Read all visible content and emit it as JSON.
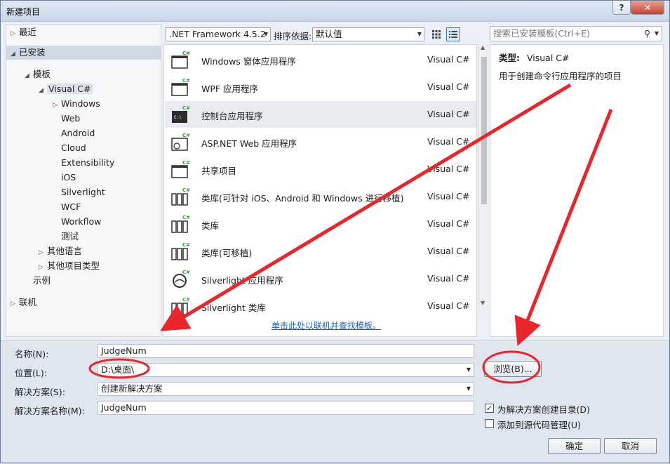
{
  "window": {
    "title": "新建项目"
  },
  "left_tree": [
    {
      "label": "最近",
      "indent": 0,
      "arrow": "▷"
    },
    {
      "label": "已安装",
      "indent": 0,
      "arrow": "◢",
      "selected": true
    },
    {
      "label": "模板",
      "indent": 1,
      "arrow": "◢"
    },
    {
      "label": "Visual C#",
      "indent": 2,
      "arrow": "◢",
      "highlight": true
    },
    {
      "label": "Windows",
      "indent": 3,
      "arrow": "▷"
    },
    {
      "label": "Web",
      "indent": 3,
      "arrow": ""
    },
    {
      "label": "Android",
      "indent": 3,
      "arrow": ""
    },
    {
      "label": "Cloud",
      "indent": 3,
      "arrow": ""
    },
    {
      "label": "Extensibility",
      "indent": 3,
      "arrow": ""
    },
    {
      "label": "iOS",
      "indent": 3,
      "arrow": ""
    },
    {
      "label": "Silverlight",
      "indent": 3,
      "arrow": ""
    },
    {
      "label": "WCF",
      "indent": 3,
      "arrow": ""
    },
    {
      "label": "Workflow",
      "indent": 3,
      "arrow": ""
    },
    {
      "label": "测试",
      "indent": 3,
      "arrow": ""
    },
    {
      "label": "其他语言",
      "indent": 2,
      "arrow": "▷"
    },
    {
      "label": "其他项目类型",
      "indent": 2,
      "arrow": "▷"
    },
    {
      "label": "示例",
      "indent": 1,
      "arrow": ""
    },
    {
      "label": "联机",
      "indent": 0,
      "arrow": "▷"
    }
  ],
  "toolbar": {
    "framework": ".NET Framework 4.5.2",
    "sort_label": "排序依据:",
    "sort_value": "默认值"
  },
  "search": {
    "placeholder": "搜索已安装模板(Ctrl+E)"
  },
  "templates": [
    {
      "name": "Windows 窗体应用程序",
      "lang": "Visual C#",
      "icon": "windows-forms-icon"
    },
    {
      "name": "WPF 应用程序",
      "lang": "Visual C#",
      "icon": "wpf-icon"
    },
    {
      "name": "控制台应用程序",
      "lang": "Visual C#",
      "icon": "console-icon",
      "selected": true
    },
    {
      "name": "ASP.NET Web 应用程序",
      "lang": "Visual C#",
      "icon": "web-app-icon"
    },
    {
      "name": "共享项目",
      "lang": "Visual C#",
      "icon": "shared-project-icon"
    },
    {
      "name": "类库(可针对 iOS、Android 和 Windows 进行移植)",
      "lang": "Visual C#",
      "icon": "portable-library-icon"
    },
    {
      "name": "类库",
      "lang": "Visual C#",
      "icon": "class-library-icon"
    },
    {
      "name": "类库(可移植)",
      "lang": "Visual C#",
      "icon": "portable-class-library-icon"
    },
    {
      "name": "Silverlight 应用程序",
      "lang": "Visual C#",
      "icon": "silverlight-app-icon"
    },
    {
      "name": "Silverlight 类库",
      "lang": "Visual C#",
      "icon": "silverlight-library-icon"
    }
  ],
  "online_link": "单击此处以联机并查找模板。",
  "details": {
    "type_label": "类型:",
    "type_value": "Visual C#",
    "description": "用于创建命令行应用程序的项目"
  },
  "form": {
    "name_label": "名称(N):",
    "name_value": "JudgeNum",
    "location_label": "位置(L):",
    "location_value": "D:\\桌面\\",
    "solution_label": "解决方案(S):",
    "solution_value": "创建新解决方案",
    "solution_name_label": "解决方案名称(M):",
    "solution_name_value": "JudgeNum",
    "browse_label": "浏览(B)...",
    "create_dir_label": "为解决方案创建目录(D)",
    "create_dir_checked": true,
    "source_control_label": "添加到源代码管理(U)",
    "source_control_checked": false,
    "ok_label": "确定",
    "cancel_label": "取消"
  },
  "colors": {
    "accent": "#3c7fb1",
    "annotation": "#e8262b",
    "link": "#1a5fb4"
  }
}
